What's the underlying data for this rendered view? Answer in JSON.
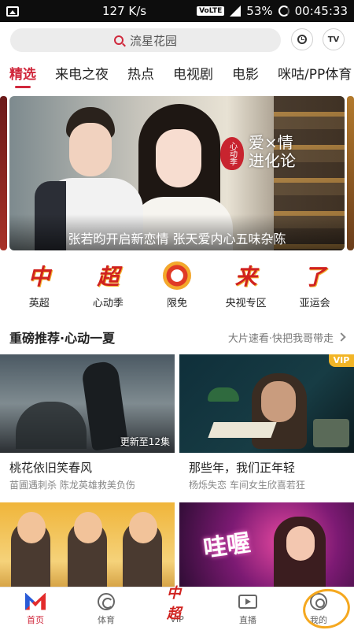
{
  "status_bar": {
    "speed": "127 K/s",
    "volte": "VoLTE",
    "battery": "53%",
    "time": "00:45:33"
  },
  "header": {
    "search_placeholder": "流星花园",
    "history_icon": "clock-icon",
    "tv_label": "TV"
  },
  "tabs": [
    "精选",
    "来电之夜",
    "热点",
    "电视剧",
    "电影",
    "咪咕/PP体育"
  ],
  "banner": {
    "logo_left": "心动季",
    "logo_right_line1": "爱×情",
    "logo_right_line2": "进化论",
    "caption": "张若昀开启新恋情 张天爱内心五味杂陈"
  },
  "quick_entries": [
    {
      "glyph": "中",
      "label": "英超"
    },
    {
      "glyph": "超",
      "label": "心动季"
    },
    {
      "glyph": "",
      "label": "限免"
    },
    {
      "glyph": "来",
      "label": "央视专区"
    },
    {
      "glyph": "了",
      "label": "亚运会"
    }
  ],
  "section": {
    "title": "重磅推荐·心动一夏",
    "more": "大片速看·快把我哥带走"
  },
  "cards": [
    {
      "title": "桃花依旧笑春风",
      "subtitle": "苗圃遇刺杀 陈龙英雄救美负伤",
      "badge": "更新至12集"
    },
    {
      "title": "那些年，我们正年轻",
      "subtitle": "杨烁失恋 车间女生欣喜若狂",
      "badge": "VIP"
    },
    {
      "title": "",
      "subtitle": "",
      "badge": ""
    },
    {
      "title": "",
      "subtitle": "",
      "badge": "",
      "overlay": "哇喔"
    }
  ],
  "bottom_nav": [
    {
      "label": "首页",
      "icon": "home-icon"
    },
    {
      "label": "体育",
      "icon": "sports-icon"
    },
    {
      "label": "中超",
      "icon": "vip-icon",
      "text_label": "VIP"
    },
    {
      "label": "直播",
      "icon": "live-icon"
    },
    {
      "label": "我的",
      "icon": "mine-icon"
    }
  ],
  "colors": {
    "accent": "#d0283c",
    "vip_gold": "#f2b527"
  }
}
